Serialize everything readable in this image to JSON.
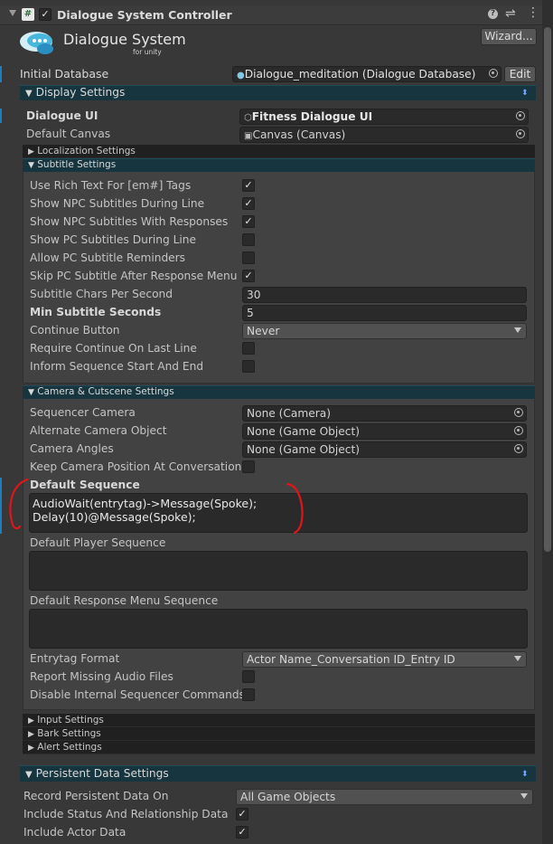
{
  "component": {
    "title": "Dialogue System Controller",
    "enabled_check": "✓",
    "logo_main": "Dialogue System",
    "logo_sub": "for unity",
    "wizard_button": "Wizard..."
  },
  "database": {
    "label": "Initial Database",
    "value": "Dialogue_meditation (Dialogue Database)",
    "edit_button": "Edit"
  },
  "display_settings": {
    "title": "Display Settings",
    "dialogue_ui": {
      "label": "Dialogue UI",
      "value": "Fitness Dialogue UI"
    },
    "default_canvas": {
      "label": "Default Canvas",
      "value": "Canvas (Canvas)"
    },
    "localization": "Localization Settings",
    "subtitle": {
      "title": "Subtitle Settings",
      "rows": [
        {
          "label": "Use Rich Text For [em#] Tags",
          "checked": "✓"
        },
        {
          "label": "Show NPC Subtitles During Line",
          "checked": "✓"
        },
        {
          "label": "Show NPC Subtitles With Responses",
          "checked": "✓"
        },
        {
          "label": "Show PC Subtitles During Line",
          "checked": ""
        },
        {
          "label": "Allow PC Subtitle Reminders",
          "checked": ""
        },
        {
          "label": "Skip PC Subtitle After Response Menu",
          "checked": "✓"
        }
      ],
      "chars_per_second": {
        "label": "Subtitle Chars Per Second",
        "value": "30"
      },
      "min_seconds": {
        "label": "Min Subtitle Seconds",
        "value": "5"
      },
      "continue_button": {
        "label": "Continue Button",
        "value": "Never"
      },
      "require_continue": {
        "label": "Require Continue On Last Line",
        "checked": ""
      },
      "inform_sequence": {
        "label": "Inform Sequence Start And End",
        "checked": ""
      }
    },
    "camera": {
      "title": "Camera & Cutscene Settings",
      "sequencer_camera": {
        "label": "Sequencer Camera",
        "value": "None (Camera)"
      },
      "alternate_camera": {
        "label": "Alternate Camera Object",
        "value": "None (Game Object)"
      },
      "camera_angles": {
        "label": "Camera Angles",
        "value": "None (Game Object)"
      },
      "keep_camera": {
        "label": "Keep Camera Position At Conversation En",
        "checked": ""
      },
      "default_sequence": {
        "label": "Default Sequence",
        "line1": "AudioWait(entrytag)->Message(Spoke);",
        "line2": "Delay(10)@Message(Spoke);"
      },
      "default_player_sequence": {
        "label": "Default Player Sequence"
      },
      "default_response_sequence": {
        "label": "Default Response Menu Sequence"
      },
      "entrytag_format": {
        "label": "Entrytag Format",
        "value": "Actor Name_Conversation ID_Entry ID"
      },
      "report_missing": {
        "label": "Report Missing Audio Files",
        "checked": ""
      },
      "disable_internal": {
        "label": "Disable Internal Sequencer Commands",
        "checked": ""
      }
    },
    "input_settings": "Input Settings",
    "bark_settings": "Bark Settings",
    "alert_settings": "Alert Settings"
  },
  "persistent": {
    "title": "Persistent Data Settings",
    "record_on": {
      "label": "Record Persistent Data On",
      "value": "All Game Objects"
    },
    "include_status": {
      "label": "Include Status And Relationship Data",
      "checked": "✓"
    },
    "include_actor": {
      "label": "Include Actor Data",
      "checked": "✓"
    }
  },
  "colors": {
    "annotation": "#e0151a",
    "section_bar": "#16353f",
    "background": "#383838"
  }
}
